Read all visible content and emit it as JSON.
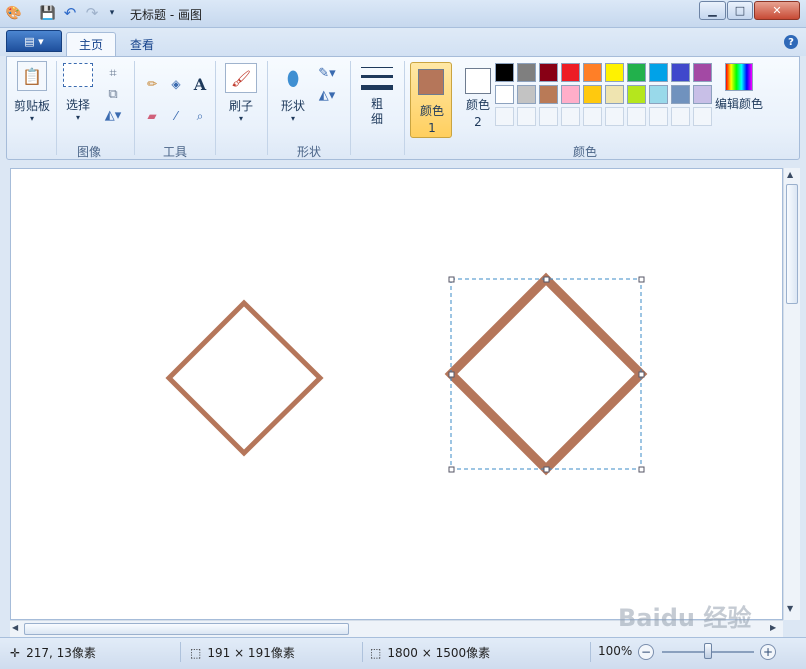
{
  "window": {
    "title": "无标题 - 画图",
    "minimize_icon": "minimize-icon",
    "maximize_icon": "maximize-icon",
    "close_icon": "close-icon"
  },
  "tabs": [
    {
      "label": "主页",
      "active": true
    },
    {
      "label": "查看",
      "active": false
    }
  ],
  "ribbon": {
    "clipboard": {
      "label": "剪贴板"
    },
    "image": {
      "select_label": "选择",
      "group_label": "图像"
    },
    "tools": {
      "group_label": "工具"
    },
    "brushes": {
      "label": "刷子"
    },
    "shapes": {
      "label": "形状",
      "group_label": "形状"
    },
    "size": {
      "label": "粗细"
    },
    "color1": {
      "label": "颜色 1",
      "color": "#b5765a"
    },
    "color2": {
      "label": "颜色 2",
      "color": "#ffffff"
    },
    "edit_colors": {
      "label": "编辑颜色"
    },
    "colors_group_label": "颜色",
    "palette_row1": [
      "#000000",
      "#7f7f7f",
      "#880015",
      "#ed1c24",
      "#ff7f27",
      "#fff200",
      "#22b14c",
      "#00a2e8",
      "#3f48cc",
      "#a349a4"
    ],
    "palette_row2": [
      "#ffffff",
      "#c3c3c3",
      "#b97a57",
      "#ffaec9",
      "#ffc90e",
      "#efe4b0",
      "#b5e61d",
      "#99d9ea",
      "#7092be",
      "#c8bfe7"
    ]
  },
  "canvas": {
    "stroke_color": "#b5765a"
  },
  "status": {
    "cursor_pos": "217, 13像素",
    "selection_size": "191 × 191像素",
    "image_size": "1800 × 1500像素",
    "zoom": "100%",
    "zoom_level": 0.5
  },
  "watermark": "Baidu 经验"
}
